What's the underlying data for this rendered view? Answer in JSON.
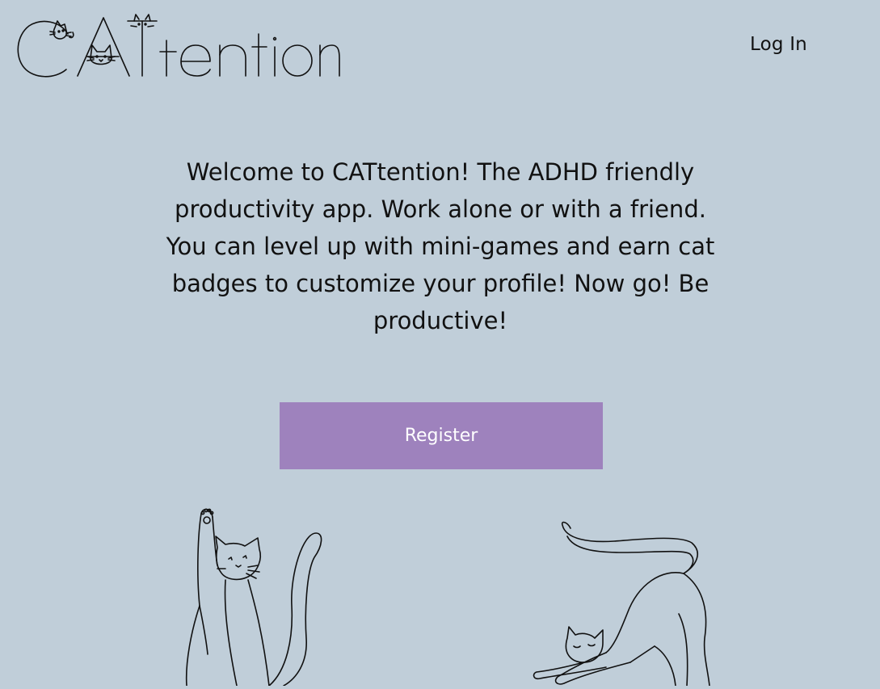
{
  "header": {
    "logo_text": "CATtention",
    "login_label": "Log In"
  },
  "main": {
    "welcome_text": "Welcome to CATtention! The ADHD friendly productivity app. Work alone or with a friend. You can level up with mini-games and earn cat badges to customize your profile!  Now go!  Be productive!",
    "register_label": "Register"
  },
  "colors": {
    "background": "#c0ced9",
    "button": "#9e82bd",
    "button_text": "#ffffff",
    "text": "#111111"
  },
  "icons": {
    "logo": "cattention-logo",
    "cat_left": "reaching-cat-illustration",
    "cat_right": "stretching-cat-illustration"
  }
}
